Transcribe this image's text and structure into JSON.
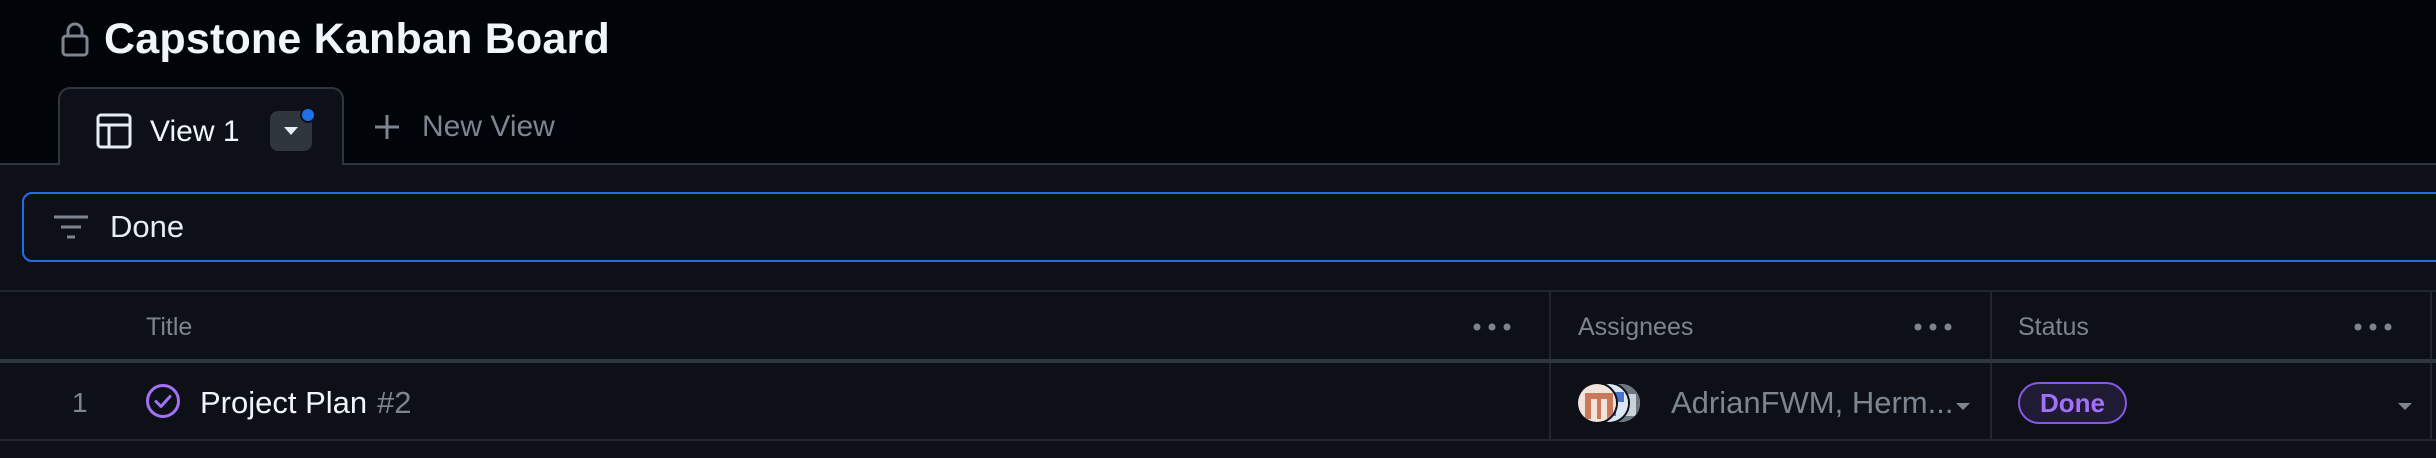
{
  "project": {
    "title": "Capstone Kanban Board",
    "icon": "lock-icon"
  },
  "tabs": {
    "active": {
      "label": "View 1",
      "icon": "table-icon"
    },
    "new_view_label": "New View"
  },
  "filter": {
    "query": "Done",
    "icon": "filter-icon"
  },
  "table": {
    "columns": [
      {
        "label": "Title"
      },
      {
        "label": "Assignees"
      },
      {
        "label": "Status"
      }
    ],
    "rows": [
      {
        "index": "1",
        "title": "Project Plan",
        "number": "#2",
        "assignees": "AdrianFWM, Herm...",
        "status": "Done"
      }
    ]
  },
  "colors": {
    "background": "#010409",
    "surface": "#0d1117",
    "accent": "#1f6feb",
    "done_purple": "#a371f7"
  }
}
